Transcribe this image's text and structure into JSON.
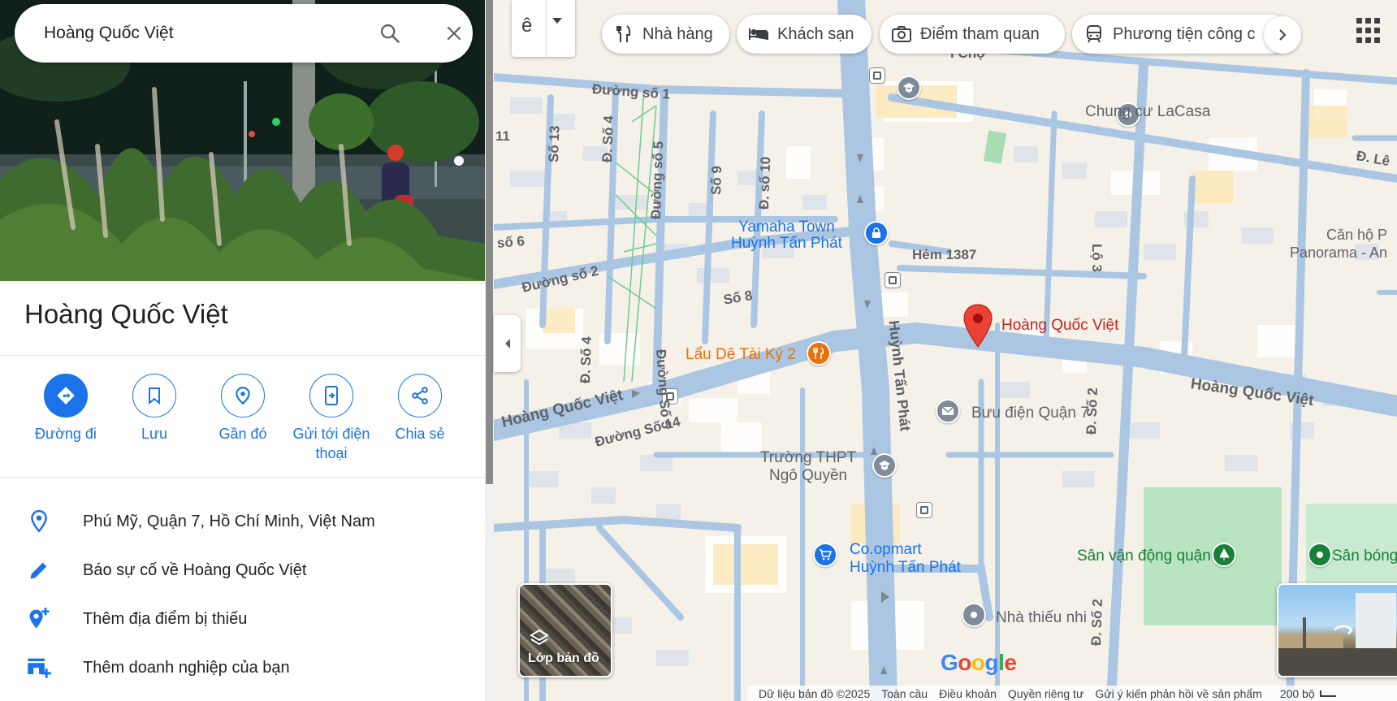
{
  "search": {
    "value": "Hoàng Quốc Việt",
    "search_icon": "search-icon",
    "clear_icon": "close-icon"
  },
  "place": {
    "title": "Hoàng Quốc Việt"
  },
  "actions": [
    {
      "label": "Đường đi",
      "icon": "directions-icon"
    },
    {
      "label": "Lưu",
      "icon": "bookmark-icon"
    },
    {
      "label": "Gần đó",
      "icon": "nearby-icon"
    },
    {
      "label": "Gửi tới điện thoại",
      "icon": "send-to-phone-icon"
    },
    {
      "label": "Chia sẻ",
      "icon": "share-icon"
    }
  ],
  "info_rows": [
    {
      "text": "Phú Mỹ, Quận 7, Hồ Chí Minh, Việt Nam",
      "icon": "location-pin-icon"
    },
    {
      "text": "Báo sự cố về Hoàng Quốc Việt",
      "icon": "edit-pencil-icon"
    },
    {
      "text": "Thêm địa điểm bị thiếu",
      "icon": "add-place-icon"
    },
    {
      "text": "Thêm doanh nghiệp của bạn",
      "icon": "add-business-icon"
    }
  ],
  "chips": [
    {
      "label": "Nhà hàng",
      "icon": "restaurant-icon"
    },
    {
      "label": "Khách sạn",
      "icon": "hotel-icon"
    },
    {
      "label": "Điểm tham quan",
      "icon": "camera-icon"
    },
    {
      "label": "Phương tiện công c",
      "icon": "transit-icon"
    }
  ],
  "map": {
    "layer_toggle_glyph": "ê",
    "layers_label": "Lớp bản đồ",
    "selected_place": "Hoàng Quốc Việt",
    "poi_labels": {
      "yamaha": "Yamaha Town\nHuỳnh Tấn Phát",
      "laude": "Lẩu Dê Tài Ký 2",
      "buudien": "Bưu điện Quận 7",
      "truong": "Trường THPT\nNgô Quyền",
      "coop": "Co.opmart\nHuỳnh Tấn Phát",
      "svd": "Sân vận động quận 7",
      "sanbong": "Sân bóng",
      "thieunhi": "Nhà thiếu nhi",
      "lacasa": "Chung cư LaCasa",
      "canho": "Căn hộ P\nPanorama - An",
      "hem": "Hẻm 1387",
      "cho": "i Chợ"
    },
    "road_labels": {
      "hqv_left": "Hoàng Quốc Việt",
      "hqv_right": "Hoàng Quốc Việt",
      "htp": "Huỳnh Tấn Phát",
      "duongso1": "Đường số 1",
      "duongso2": "Đường số 2",
      "duongso14": "Đường Số 14",
      "so8": "Số 8",
      "so13": "Số 13",
      "dso4a": "Đ. Số 4",
      "dso4b": "Đ. Số 4",
      "duongso5a": "Đường số 5",
      "duongso5b": "Đường Số 5",
      "so9": "Số 9",
      "dso10": "Đ. số 10",
      "so6": "số 6",
      "n11": "11",
      "dle": "Đ. Lê",
      "lo3": "Lộ 3",
      "dso2a": "Đ. Số 2",
      "dso2b": "Đ. Số 2"
    },
    "google_letters": [
      "G",
      "o",
      "o",
      "g",
      "l",
      "e"
    ]
  },
  "footer": {
    "items": [
      "Dữ liệu bản đồ ©2025",
      "Toàn cầu",
      "Điều khoản",
      "Quyền riêng tư",
      "Gửi ý kiến phản hồi về sản phẩm"
    ],
    "scale": "200 bộ"
  },
  "colors": {
    "accent": "#1a73e8",
    "pin": "#ea4335",
    "map_bg": "#f5f1e8",
    "road": "#aac6e3"
  }
}
